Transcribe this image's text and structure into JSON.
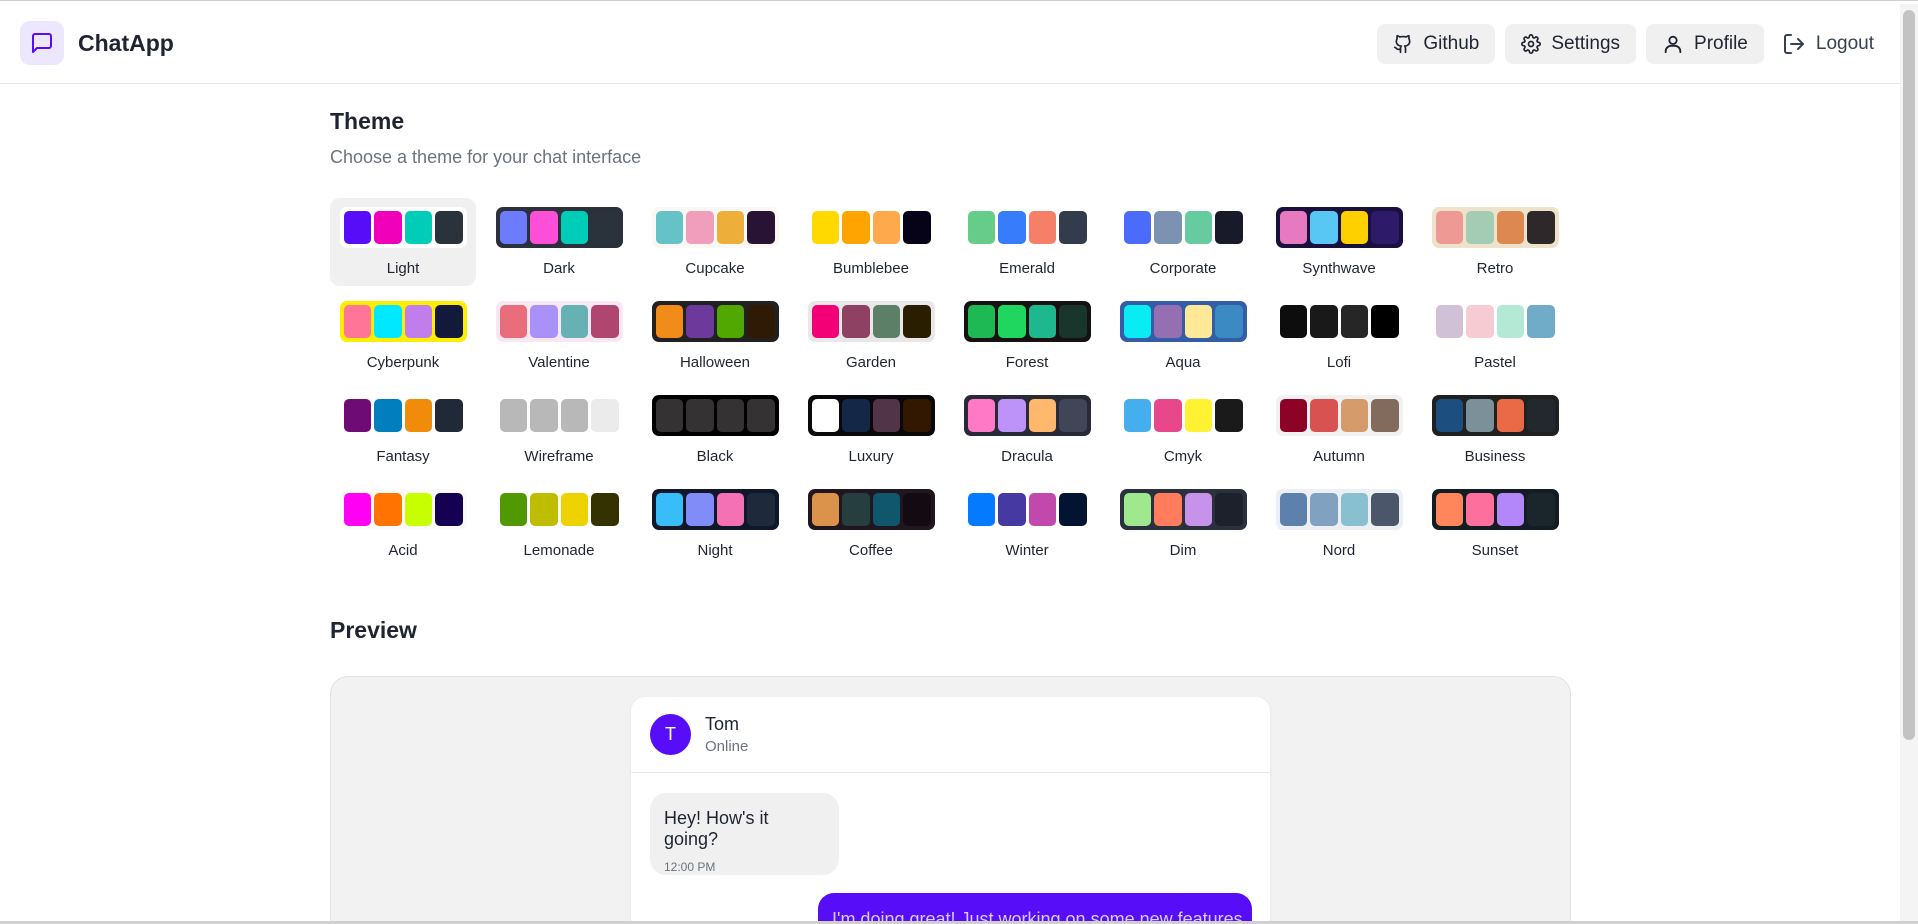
{
  "app": {
    "name": "ChatApp",
    "icon": "message-square-icon",
    "accent": "#570df8"
  },
  "nav": {
    "github": "Github",
    "settings": "Settings",
    "profile": "Profile",
    "logout": "Logout"
  },
  "theme_section": {
    "title": "Theme",
    "subtitle": "Choose a theme for your chat interface",
    "selected": "Light",
    "themes": [
      {
        "name": "Light",
        "bg": "#ffffff",
        "colors": [
          "#570df8",
          "#f000b8",
          "#00cdb7",
          "#2a323c"
        ]
      },
      {
        "name": "Dark",
        "bg": "#2a303c",
        "colors": [
          "#6d7cff",
          "#ff4fd8",
          "#00cdb7",
          "#2a323c"
        ]
      },
      {
        "name": "Cupcake",
        "bg": "#faf7f5",
        "colors": [
          "#65c3c8",
          "#ef9fbc",
          "#eeaf3a",
          "#291334"
        ]
      },
      {
        "name": "Bumblebee",
        "bg": "#ffffff",
        "colors": [
          "#ffd900",
          "#ffa400",
          "#ffa94d",
          "#060318"
        ]
      },
      {
        "name": "Emerald",
        "bg": "#ffffff",
        "colors": [
          "#66cc8a",
          "#377cfb",
          "#f68067",
          "#333c4d"
        ]
      },
      {
        "name": "Corporate",
        "bg": "#ffffff",
        "colors": [
          "#4b6bfb",
          "#7b92b2",
          "#67cba0",
          "#181a2a"
        ]
      },
      {
        "name": "Synthwave",
        "bg": "#1a103d",
        "colors": [
          "#e779c1",
          "#58c7f3",
          "#ffd000",
          "#2d1b69"
        ]
      },
      {
        "name": "Retro",
        "bg": "#ece3ca",
        "colors": [
          "#ef9995",
          "#a4cbb4",
          "#dc8850",
          "#2e282a"
        ]
      },
      {
        "name": "Cyberpunk",
        "bg": "#ffee00",
        "colors": [
          "#ff7598",
          "#00e8ff",
          "#c07eec",
          "#111a3b"
        ]
      },
      {
        "name": "Valentine",
        "bg": "#fae7f4",
        "colors": [
          "#e96d7b",
          "#a991f7",
          "#66b1b3",
          "#af4670"
        ]
      },
      {
        "name": "Halloween",
        "bg": "#212121",
        "colors": [
          "#f28c18",
          "#6d3a9c",
          "#51a800",
          "#2f1b05"
        ]
      },
      {
        "name": "Garden",
        "bg": "#e9e7e7",
        "colors": [
          "#f40076",
          "#8e4162",
          "#5c7f67",
          "#291e00"
        ]
      },
      {
        "name": "Forest",
        "bg": "#171212",
        "colors": [
          "#1eb854",
          "#1fd65f",
          "#1db88e",
          "#19362d"
        ]
      },
      {
        "name": "Aqua",
        "bg": "#345da7",
        "colors": [
          "#09ecf3",
          "#966fb3",
          "#ffe999",
          "#3b8ac4"
        ]
      },
      {
        "name": "Lofi",
        "bg": "#ffffff",
        "colors": [
          "#0d0d0d",
          "#1a1919",
          "#262626",
          "#000000"
        ]
      },
      {
        "name": "Pastel",
        "bg": "#ffffff",
        "colors": [
          "#d1c1d7",
          "#f6cbd1",
          "#b4e9d6",
          "#70acc7"
        ]
      },
      {
        "name": "Fantasy",
        "bg": "#ffffff",
        "colors": [
          "#6e0b75",
          "#007ebd",
          "#f18b0a",
          "#1f2937"
        ]
      },
      {
        "name": "Wireframe",
        "bg": "#ffffff",
        "colors": [
          "#b8b8b8",
          "#b8b8b8",
          "#b8b8b8",
          "#ebebeb"
        ]
      },
      {
        "name": "Black",
        "bg": "#000000",
        "colors": [
          "#343232",
          "#343232",
          "#343232",
          "#343232"
        ]
      },
      {
        "name": "Luxury",
        "bg": "#09090b",
        "colors": [
          "#ffffff",
          "#152747",
          "#513448",
          "#331800"
        ]
      },
      {
        "name": "Dracula",
        "bg": "#282a36",
        "colors": [
          "#ff79c6",
          "#bd93f9",
          "#ffb86c",
          "#414558"
        ]
      },
      {
        "name": "Cmyk",
        "bg": "#ffffff",
        "colors": [
          "#45aeee",
          "#e8488a",
          "#fff232",
          "#1a1a1a"
        ]
      },
      {
        "name": "Autumn",
        "bg": "#f1f1f1",
        "colors": [
          "#8c0327",
          "#d85251",
          "#d59b6a",
          "#826a5c"
        ]
      },
      {
        "name": "Business",
        "bg": "#202020",
        "colors": [
          "#1c4e80",
          "#7c909a",
          "#ea6947",
          "#23282e"
        ]
      },
      {
        "name": "Acid",
        "bg": "#fafafa",
        "colors": [
          "#ff00f4",
          "#ff7400",
          "#c8ff00",
          "#140152"
        ]
      },
      {
        "name": "Lemonade",
        "bg": "#ffffff",
        "colors": [
          "#519903",
          "#bebe00",
          "#eed200",
          "#343300"
        ]
      },
      {
        "name": "Night",
        "bg": "#0f1729",
        "colors": [
          "#38bdf8",
          "#818cf8",
          "#f471b5",
          "#1e293b"
        ]
      },
      {
        "name": "Coffee",
        "bg": "#20161f",
        "colors": [
          "#db924b",
          "#263e3f",
          "#10576d",
          "#120c12"
        ]
      },
      {
        "name": "Winter",
        "bg": "#ffffff",
        "colors": [
          "#047aff",
          "#463aa2",
          "#c148ac",
          "#021431"
        ]
      },
      {
        "name": "Dim",
        "bg": "#2a303c",
        "colors": [
          "#9fe88d",
          "#ff7d5c",
          "#c792e9",
          "#1c212b"
        ]
      },
      {
        "name": "Nord",
        "bg": "#eceff4",
        "colors": [
          "#5e81ac",
          "#81a1c1",
          "#88c0d0",
          "#4c566a"
        ]
      },
      {
        "name": "Sunset",
        "bg": "#121c22",
        "colors": [
          "#ff865b",
          "#fd6f9c",
          "#b387fa",
          "#1b262c"
        ]
      }
    ]
  },
  "preview": {
    "title": "Preview",
    "contact_initial": "T",
    "contact_name": "Tom",
    "contact_status": "Online",
    "message_in": "Hey! How's it going?",
    "message_in_time": "12:00 PM",
    "message_out": "I'm doing great! Just working on some new features."
  }
}
